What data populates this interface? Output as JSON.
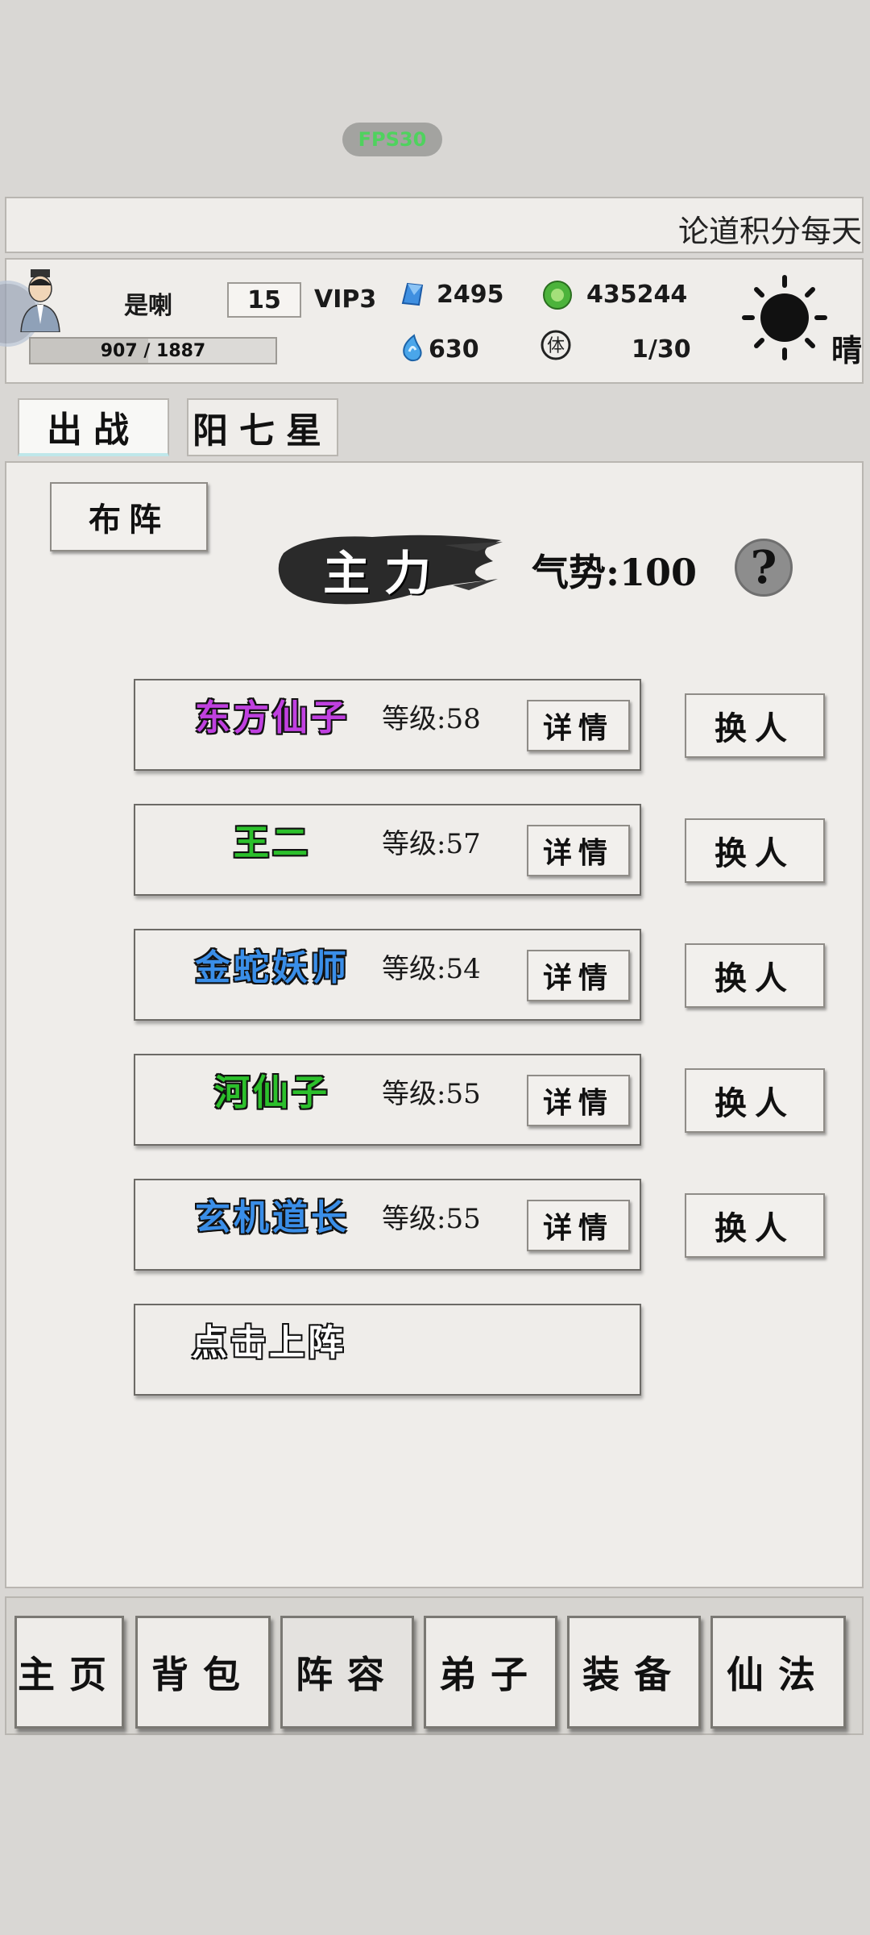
{
  "fps": "FPS30",
  "ticker": "论道积分每天",
  "player": {
    "name": "是喇",
    "level": "15",
    "vip": "VIP3",
    "exp_text": "907 / 1887",
    "exp_fraction": 0.48
  },
  "resources": {
    "crystal": "2495",
    "jade": "435244",
    "spirit": "630",
    "stamina": "1/30",
    "weather": "晴"
  },
  "tabs": [
    {
      "label": "出战"
    },
    {
      "label": "阳七星"
    }
  ],
  "arrange_label": "布阵",
  "main_force_label": "主力",
  "momentum": "气势:100",
  "help_label": "?",
  "members": [
    {
      "name": "东方仙子",
      "color": "#c040e0",
      "level": "等级:58",
      "detail": "详情",
      "swap": "换人"
    },
    {
      "name": "王二",
      "color": "#2cc02c",
      "level": "等级:57",
      "detail": "详情",
      "swap": "换人"
    },
    {
      "name": "金蛇妖师",
      "color": "#3a8ee8",
      "level": "等级:54",
      "detail": "详情",
      "swap": "换人"
    },
    {
      "name": "河仙子",
      "color": "#2cc02c",
      "level": "等级:55",
      "detail": "详情",
      "swap": "换人"
    },
    {
      "name": "玄机道长",
      "color": "#3a8ee8",
      "level": "等级:55",
      "detail": "详情",
      "swap": "换人"
    }
  ],
  "empty_slot_label": "点击上阵",
  "nav": [
    {
      "label": "主页",
      "icon": "home"
    },
    {
      "label": "背包",
      "icon": "bag"
    },
    {
      "label": "阵容",
      "icon": "lineup",
      "active": true
    },
    {
      "label": "弟子",
      "icon": "disciple"
    },
    {
      "label": "装备",
      "icon": "equipment"
    },
    {
      "label": "仙法",
      "icon": "magic"
    }
  ]
}
